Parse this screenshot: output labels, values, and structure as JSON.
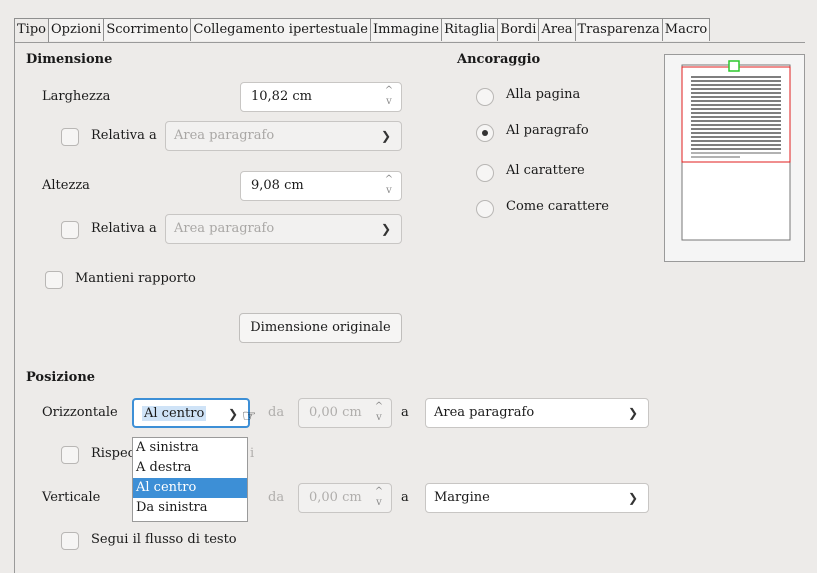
{
  "tabs": [
    "Tipo",
    "Opzioni",
    "Scorrimento",
    "Collegamento ipertestuale",
    "Immagine",
    "Ritaglia",
    "Bordi",
    "Area",
    "Trasparenza",
    "Macro"
  ],
  "size": {
    "heading": "Dimensione",
    "width_label": "Larghezza",
    "width_value": "10,82 cm",
    "relative_label": "Relativa a",
    "relative_value": "Area paragrafo",
    "height_label": "Altezza",
    "height_value": "9,08 cm",
    "relative2_label": "Relativa a",
    "relative2_value": "Area paragrafo",
    "keep_ratio_label": "Mantieni rapporto",
    "original_size_label": "Dimensione originale"
  },
  "anchor": {
    "heading": "Ancoraggio",
    "options": [
      "Alla pagina",
      "Al paragrafo",
      "Al carattere",
      "Come carattere"
    ],
    "selected": "Al paragrafo"
  },
  "position": {
    "heading": "Posizione",
    "horizontal_label": "Orizzontale",
    "horizontal_value": "Al centro",
    "by_label": "da",
    "by_value": "0,00 cm",
    "to_label": "a",
    "horizontal_to_value": "Area paragrafo",
    "mirror_label": "Rispec",
    "mirror_tail": "i",
    "vertical_label": "Verticale",
    "vertical_by_label": "da",
    "vertical_by_value": "0,00 cm",
    "vertical_to_label": "a",
    "vertical_to_value": "Margine",
    "follow_flow_label": "Segui il flusso di testo"
  },
  "horizontal_dropdown": {
    "options": [
      "A sinistra",
      "A destra",
      "Al centro",
      "Da sinistra"
    ],
    "selected": "Al centro"
  },
  "colors": {
    "accent": "#3d8fd6",
    "preview_frame": "#e01e1e",
    "preview_anchor": "#2cc82c"
  }
}
